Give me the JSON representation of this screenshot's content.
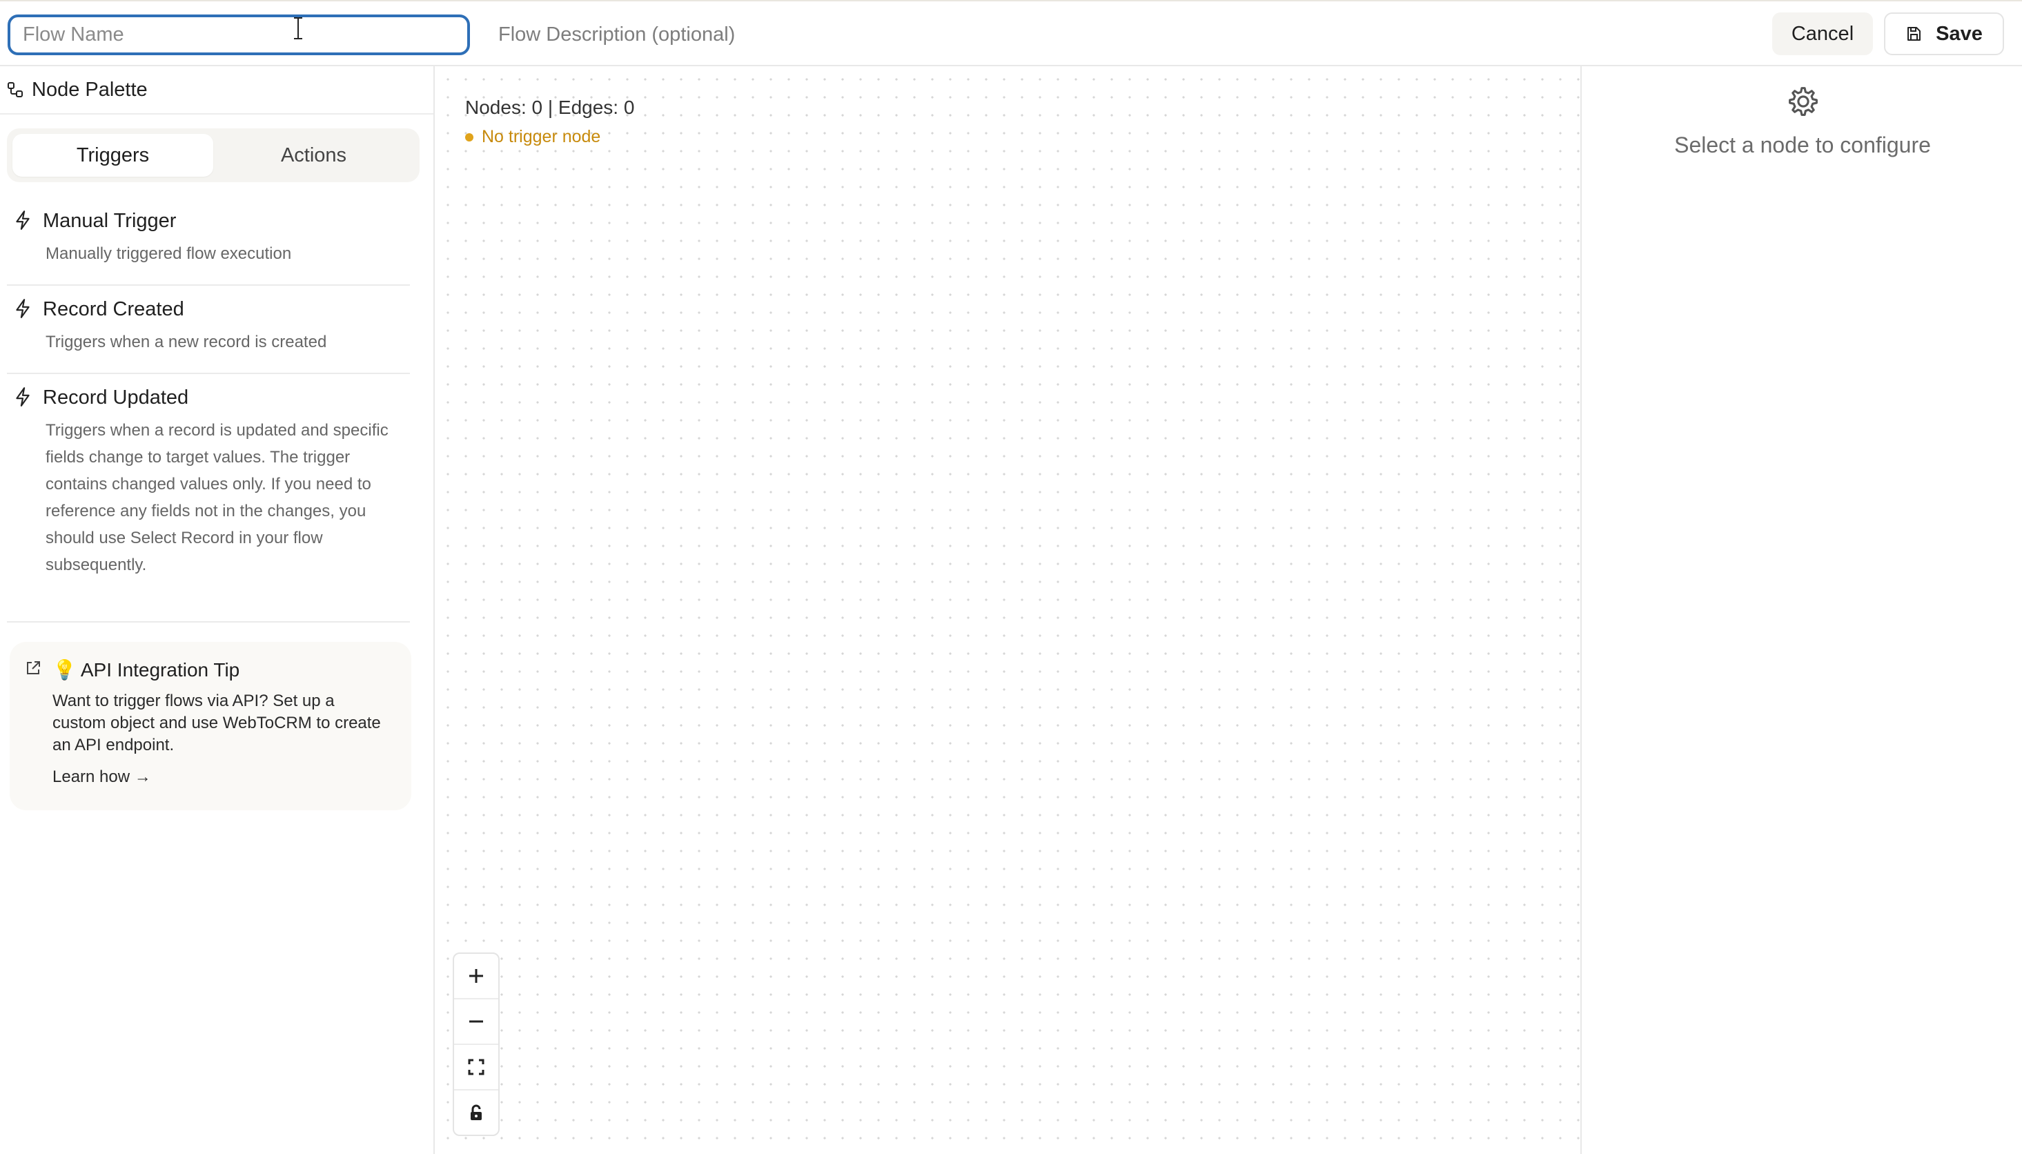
{
  "header": {
    "flow_name_placeholder": "Flow Name",
    "flow_name_value": "",
    "flow_description_placeholder": "Flow Description (optional)",
    "flow_description_value": "",
    "cancel_label": "Cancel",
    "save_label": "Save"
  },
  "palette": {
    "title": "Node Palette",
    "tabs": [
      {
        "label": "Triggers",
        "active": true
      },
      {
        "label": "Actions",
        "active": false
      }
    ],
    "items": [
      {
        "icon": "lightning-icon",
        "title": "Manual Trigger",
        "description": "Manually triggered flow execution"
      },
      {
        "icon": "lightning-icon",
        "title": "Record Created",
        "description": "Triggers when a new record is created"
      },
      {
        "icon": "lightning-icon",
        "title": "Record Updated",
        "description": "Triggers when a record is updated and specific fields change to target values. The trigger contains changed values only. If you need to reference any fields not in the changes, you should use Select Record in your flow subsequently."
      }
    ],
    "tip": {
      "emoji": "💡",
      "title": "API Integration Tip",
      "body": "Want to trigger flows via API? Set up a custom object and use WebToCRM to create an API endpoint.",
      "link": "Learn how →"
    }
  },
  "canvas": {
    "counts": "Nodes: 0 | Edges: 0",
    "warning": "No trigger node",
    "warning_color": "#e0a31b",
    "zoom_controls": [
      "zoom-in",
      "zoom-out",
      "fit-view",
      "lock"
    ]
  },
  "config": {
    "empty_text": "Select a node to configure"
  },
  "colors": {
    "focus_border": "#2e6fb7",
    "warning_text": "#c78a0c"
  }
}
